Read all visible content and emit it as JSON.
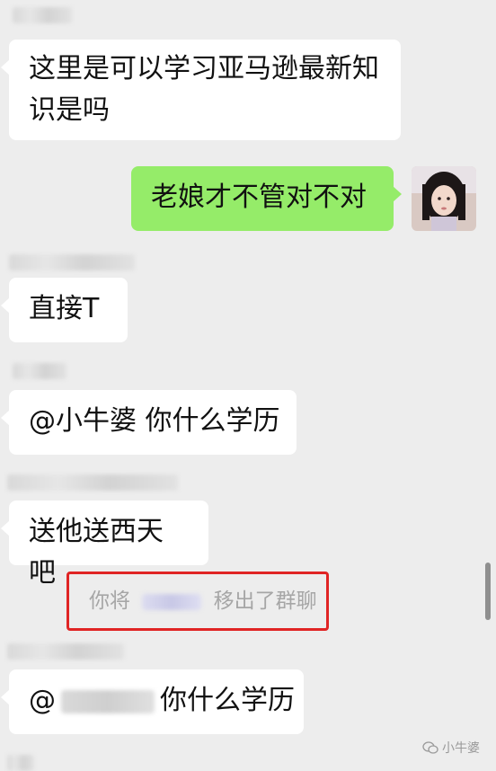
{
  "messages": [
    {
      "text": "这里是可以学习亚马逊最新知识是吗"
    },
    {
      "text": "老娘才不管对不对"
    },
    {
      "text": "直接T"
    },
    {
      "text": "@小牛婆 你什么学历"
    },
    {
      "text": "送他送西天吧"
    },
    {
      "mention_prefix": "@",
      "text": "你什么学历"
    }
  ],
  "system_notice": {
    "prefix": "你将",
    "suffix": "移出了群聊"
  },
  "watermark": {
    "label": "小牛婆"
  },
  "colors": {
    "background": "#ededed",
    "self_bubble": "#95ec69",
    "other_bubble": "#ffffff",
    "highlight_border": "#e02424"
  }
}
